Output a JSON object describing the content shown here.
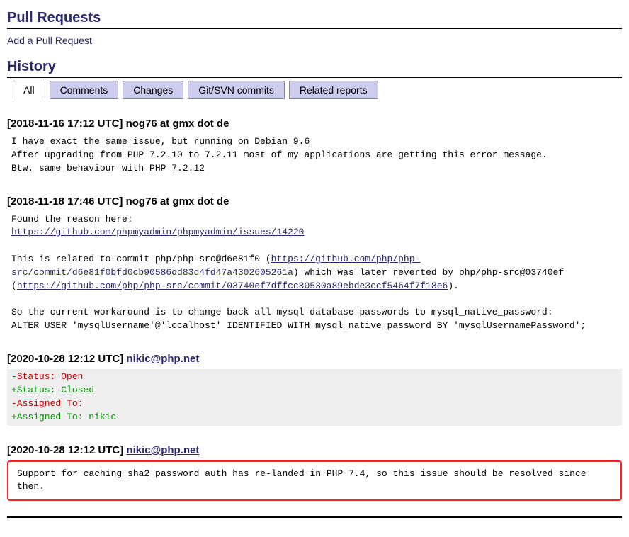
{
  "sections": {
    "pull_requests_title": "Pull Requests",
    "add_pr_label": "Add a Pull Request",
    "history_title": "History"
  },
  "tabs": [
    {
      "label": "All",
      "active": true
    },
    {
      "label": "Comments",
      "active": false
    },
    {
      "label": "Changes",
      "active": false
    },
    {
      "label": "Git/SVN commits",
      "active": false
    },
    {
      "label": "Related reports",
      "active": false
    }
  ],
  "comments": [
    {
      "timestamp": "[2018-11-16 17:12 UTC]",
      "author": "nog76 at gmx dot de",
      "author_is_link": false,
      "body_parts": [
        {
          "t": "text",
          "v": "I have exact the same issue, but running on Debian 9.6\nAfter upgrading from PHP 7.2.10 to 7.2.11 most of my applications are getting this error message.\nBtw. same behaviour with PHP 7.2.12"
        }
      ]
    },
    {
      "timestamp": "[2018-11-18 17:46 UTC]",
      "author": "nog76 at gmx dot de",
      "author_is_link": false,
      "body_parts": [
        {
          "t": "text",
          "v": "Found the reason here:\n"
        },
        {
          "t": "link",
          "v": "https://github.com/phpmyadmin/phpmyadmin/issues/14220"
        },
        {
          "t": "text",
          "v": "\n\nThis is related to commit php/php-src@d6e81f0 ("
        },
        {
          "t": "link",
          "v": "https://github.com/php/php-src/commit/d6e81f0bfd0cb90586dd83d4fd47a4302605261a"
        },
        {
          "t": "text",
          "v": ") which was later reverted by php/php-src@03740ef ("
        },
        {
          "t": "link",
          "v": "https://github.com/php/php-src/commit/03740ef7dffcc80530a89ebde3ccf5464f7f18e6"
        },
        {
          "t": "text",
          "v": ").\n\nSo the current workaround is to change back all mysql-database-passwords to mysql_native_password:\nALTER USER 'mysqlUsername'@'localhost' IDENTIFIED WITH mysql_native_password BY 'mysqlUsernamePassword';"
        }
      ]
    },
    {
      "timestamp": "[2020-10-28 12:12 UTC]",
      "author": "nikic@php.net",
      "author_is_link": true,
      "change_lines": [
        {
          "type": "removed",
          "v": "-Status: Open"
        },
        {
          "type": "added",
          "v": "+Status: Closed"
        },
        {
          "type": "removed",
          "v": "-Assigned To:"
        },
        {
          "type": "added",
          "v": "+Assigned To: nikic"
        }
      ]
    },
    {
      "timestamp": "[2020-10-28 12:12 UTC]",
      "author": "nikic@php.net",
      "author_is_link": true,
      "highlight": true,
      "body_parts": [
        {
          "t": "text",
          "v": "Support for caching_sha2_password auth has re-landed in PHP 7.4, so this issue should be resolved since then."
        }
      ]
    }
  ]
}
